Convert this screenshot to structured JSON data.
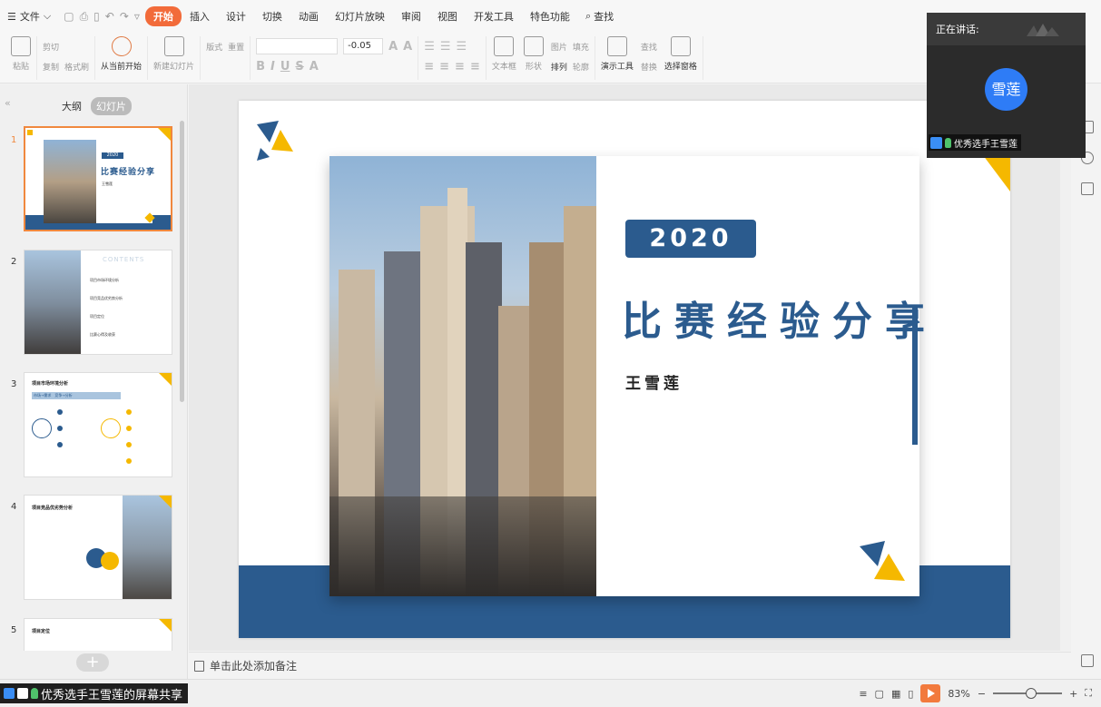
{
  "menu": {
    "file": "文件",
    "tabs": [
      "开始",
      "插入",
      "设计",
      "切换",
      "动画",
      "幻灯片放映",
      "审阅",
      "视图",
      "开发工具",
      "特色功能"
    ],
    "search": "查找"
  },
  "ribbon": {
    "paste": "粘贴",
    "cut": "剪切",
    "copy": "复制",
    "format_painter": "格式刷",
    "from_current": "从当前开始",
    "new_slide": "新建幻灯片",
    "layout": "版式",
    "reset": "重置",
    "font_size": "-0.05",
    "textbox": "文本框",
    "shape": "形状",
    "image": "图片",
    "fill": "填充",
    "arrange": "排列",
    "outline": "轮廓",
    "find": "查找",
    "replace": "替换",
    "presentation_tools": "演示工具",
    "selection_pane": "选择窗格"
  },
  "leftpanel": {
    "collapse": "«",
    "outline_tab": "大纲",
    "slides_tab": "幻灯片",
    "add": "+",
    "thumbs": [
      {
        "num": "1",
        "year": "2020",
        "title": "比赛经验分享",
        "author": "王雪莲"
      },
      {
        "num": "2",
        "heading": "CONTENTS",
        "items": [
          "项目市场环境分析",
          "项目竞品优劣势分析",
          "项目定位",
          "比赛心得及收获"
        ]
      },
      {
        "num": "3",
        "heading": "项目市场环境分析",
        "sub": "市场→需求　竞争→分析"
      },
      {
        "num": "4",
        "heading": "项目竞品优劣势分析"
      },
      {
        "num": "5",
        "heading": "项目定位"
      }
    ]
  },
  "slide": {
    "year": "2020",
    "title": "比赛经验分享",
    "author": "王雪莲"
  },
  "notes": {
    "placeholder": "单击此处添加备注"
  },
  "status": {
    "share": "优秀选手王雪莲的屏幕共享",
    "zoom": "83%",
    "minus": "−",
    "plus": "+"
  },
  "speaker": {
    "header": "正在讲话:",
    "avatar": "雪莲",
    "name": "优秀选手王雪莲"
  },
  "colors": {
    "accent": "#2b5b8e",
    "brand_orange": "#f26b3a",
    "yellow": "#f5b800"
  }
}
